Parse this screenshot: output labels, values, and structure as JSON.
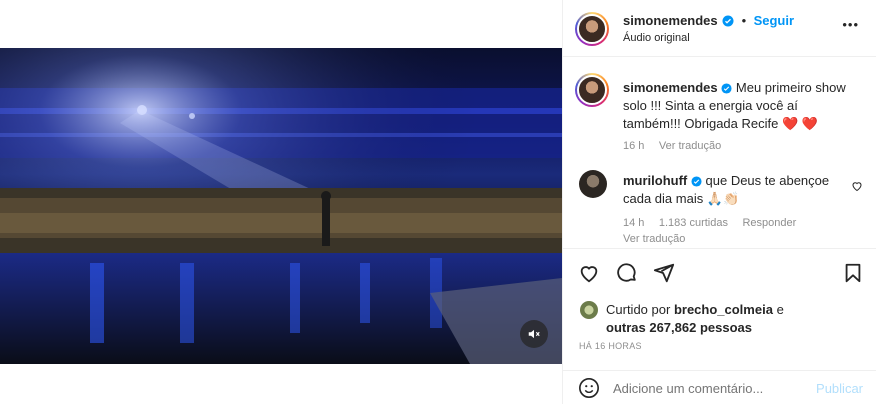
{
  "post": {
    "audio_label": "Áudio original",
    "follow_label": "Seguir",
    "more_label": "•••"
  },
  "author": {
    "username": "simonemendes"
  },
  "caption": {
    "username": "simonemendes",
    "text": "Meu primeiro show solo !!! Sinta a energia você aí também!!! Obrigada Recife ❤️ ❤️",
    "time": "16 h",
    "translate": "Ver tradução"
  },
  "comments": [
    {
      "username": "murilohuff",
      "text": "que Deus te abençoe cada dia mais 🙏🏻👏🏻",
      "time": "14 h",
      "likes": "1.183 curtidas",
      "reply": "Responder",
      "translate": "Ver tradução"
    }
  ],
  "likes": {
    "prefix": "Curtido por",
    "liked_by": "brecho_colmeia",
    "conj": "e",
    "others": "outras 267,862 pessoas"
  },
  "timestamp": "HÁ 16 HORAS",
  "comment_input": {
    "placeholder": "Adicione um comentário...",
    "post_label": "Publicar"
  },
  "colors": {
    "accent": "#0095f6",
    "heart": "#ed4956",
    "verified": "#0095f6"
  },
  "icons": {
    "like": "heart-icon",
    "comment": "comment-icon",
    "share": "paper-plane-icon",
    "save": "bookmark-icon",
    "emoji": "smiley-icon",
    "mute": "speaker-muted-icon",
    "more": "more-options-icon"
  }
}
